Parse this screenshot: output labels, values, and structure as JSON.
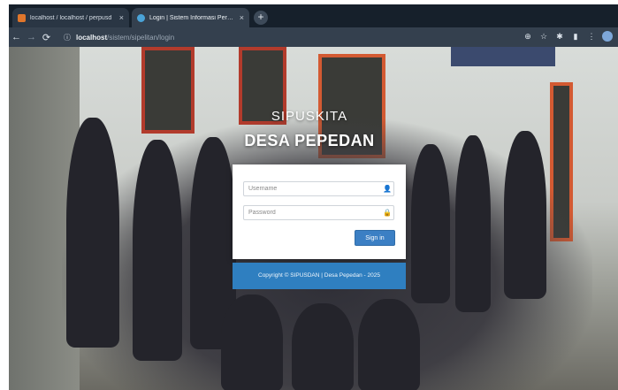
{
  "browser": {
    "tabs": [
      {
        "title": "localhost / localhost / perpusd",
        "active": false
      },
      {
        "title": "Login | Sistem Informasi Perpus",
        "active": true
      }
    ],
    "new_tab_icon": "plus-icon",
    "nav": {
      "back": "←",
      "forward": "→",
      "reload": "⟳"
    },
    "url": {
      "host": "localhost",
      "path": "/sistem/sipelitan/login"
    }
  },
  "hero": {
    "small_title": "SIPUSKITA",
    "big_title": "DESA PEPEDAN"
  },
  "login": {
    "username_placeholder": "Username",
    "password_placeholder": "Password",
    "signin_label": "Sign in",
    "username_icon": "user-icon",
    "password_icon": "lock-icon"
  },
  "footer": {
    "copyright": "Copyright © SIPUSDAN | Desa Pepedan - 2025"
  },
  "colors": {
    "accent": "#3b7fc4",
    "footer_bg": "#2f7fc0",
    "chrome_bg": "#34404e"
  }
}
